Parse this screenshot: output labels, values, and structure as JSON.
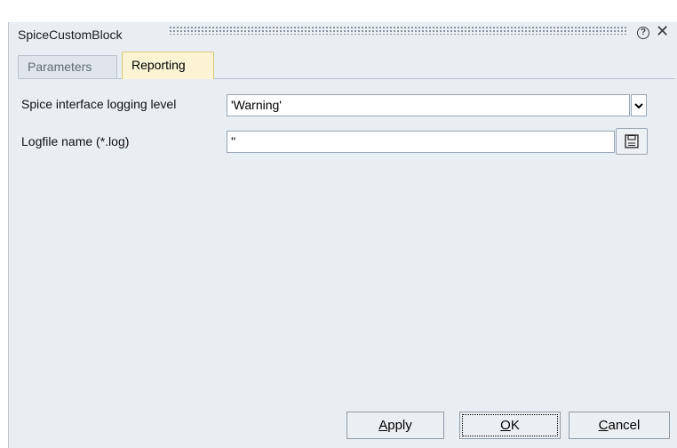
{
  "window": {
    "title": "SpiceCustomBlock"
  },
  "tabs": [
    {
      "label": "Parameters",
      "active": false
    },
    {
      "label": "Reporting",
      "active": true
    }
  ],
  "form": {
    "logging_level_label": "Spice interface logging level",
    "logging_level_value": "'Warning'",
    "logfile_label": "Logfile name (*.log)",
    "logfile_value": "''"
  },
  "buttons": {
    "apply": {
      "label": "Apply",
      "mnemonic": "A"
    },
    "ok": {
      "label": "OK",
      "mnemonic": "O"
    },
    "cancel": {
      "label": "Cancel",
      "mnemonic": "C"
    }
  },
  "colors": {
    "dialog_bg": "#e9eef3",
    "active_tab_bg": "#fbf3d4"
  },
  "icons": {
    "help": "help-icon",
    "close": "close-icon",
    "dropdown": "chevron-down-icon",
    "save": "save-icon"
  }
}
